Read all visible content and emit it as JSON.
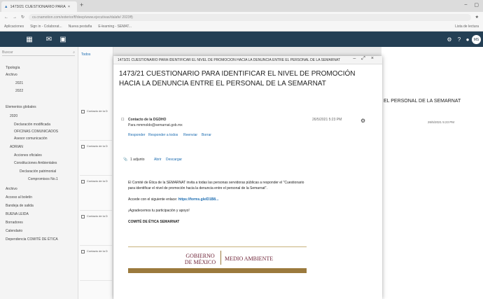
{
  "browser": {
    "tab_title": "1473/21 CUESTIONARIO PARA",
    "url": "cs.cnamotion.com/exterior/ff/deep/www.ejecutivas/dalafe/ 2023ff)",
    "bookmarks": [
      "Aplicaciones",
      "Sign in - Colaborat...",
      "Nueva pestaña",
      "E-learning - SEMAT..."
    ],
    "right_bookmark": "Lista de lectura"
  },
  "app": {
    "avatar": "MS"
  },
  "left": {
    "search": "Buscar",
    "folders": [
      "Tipología",
      "Archivo",
      "2021",
      "2022",
      "Elementos globales",
      "2020",
      "Declaración modificada",
      "OFICINAS COMUNICADOS",
      "Asesor comunicación",
      "ADRIAN",
      "Acciones oficiales",
      "Constituciones Ambientales",
      "Declaración patrimonial",
      "Compromisos No.1",
      "Archivo",
      "Acceso al boletín",
      "Bandeja de salida",
      "BUENA LEIDA",
      "Borradores",
      "Calendario",
      "Dependencia COMITÉ DE ÉTICA"
    ]
  },
  "list": {
    "header": "Todos",
    "item_label": "Contacto de la D"
  },
  "dialog": {
    "title": "1473/21 CUESTIONARIO PARA IDENTIFICAR EL NIVEL DE PROMOCIÓN HACIA LA DENUNCIA ENTRE EL PERSONAL DE LA SEMARNAT",
    "subject": "1473/21 CUESTIONARIO PARA IDENTIFICAR EL NIVEL DE PROMOCIÓN HACIA LA DENUNCIA ENTRE EL PERSONAL DE LA SEMARNAT",
    "from": "Contacto de la DGDHO",
    "to": "Para  mmmoldo@semarnat.gob.mx",
    "date": "26/5/2021 5:23 PM",
    "actions": [
      "Responder",
      "Responder a todos",
      "Reenviar",
      "Borrar"
    ],
    "attachment": "1 adjunto",
    "attachment_actions": [
      "Abrir",
      "Descargar"
    ],
    "body_p1": "El Comité de Ética de la SEMARNAT invita a todas las personas servidoras públicas a responder el \"Cuestionario para identificar el nivel de promoción hacia la denuncia entre el personal de la Semarnat\".",
    "body_p2_prefix": "Accede con el siguiente enlace:",
    "body_link": "https://forms.gle/D1B8...",
    "body_p3": "¡Agradecemos tu participación y apoyo!",
    "signature": "COMITÉ DE ÉTICA SEMARNAT",
    "logo_gov": "GOBIERNO DE MÉXICO",
    "logo_dept": "MEDIO AMBIENTE"
  },
  "right": {
    "subject_tail": "EL PERSONAL DE LA SEMARNAT",
    "date": "26/5/2021 5:23 PM"
  }
}
